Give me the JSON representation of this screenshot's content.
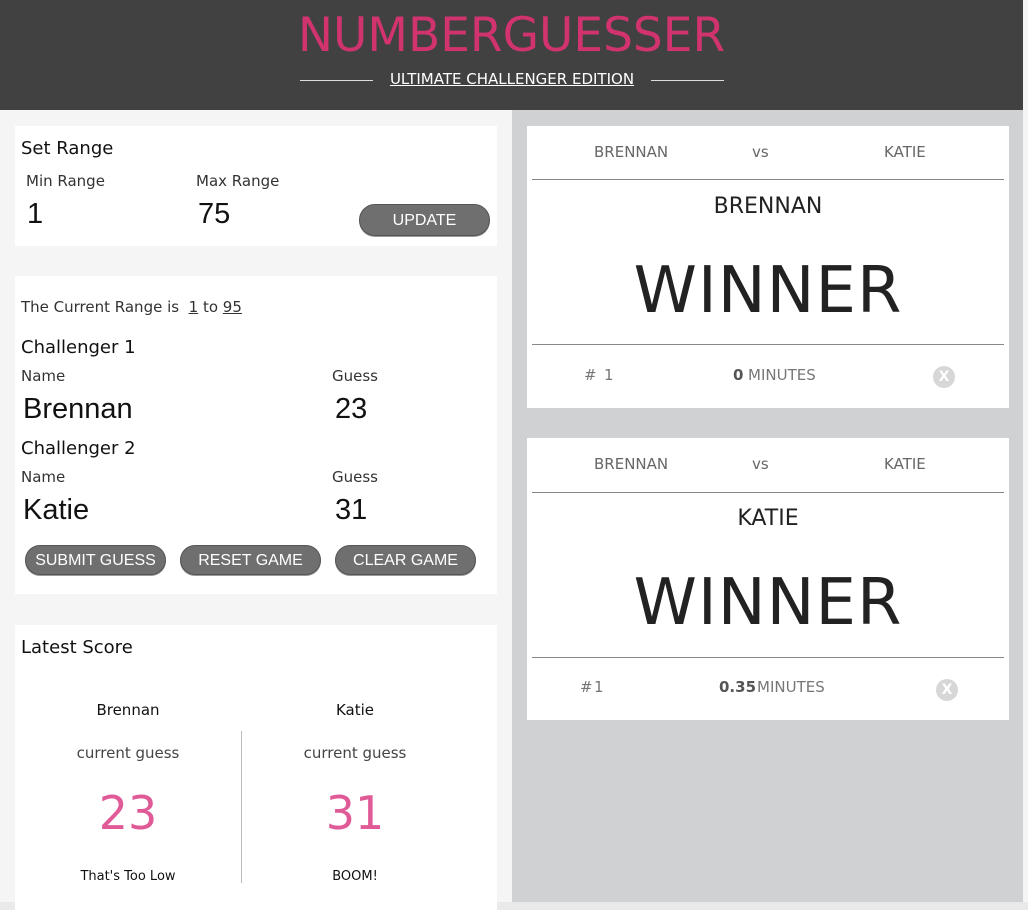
{
  "header": {
    "title": "NUMBERGUESSER",
    "subtitle": "ULTIMATE CHALLENGER EDITION"
  },
  "set_range": {
    "heading": "Set Range",
    "min_label": "Min Range",
    "max_label": "Max Range",
    "min_value": "1",
    "max_value": "75",
    "update_label": "UPDATE"
  },
  "challenge": {
    "range_prefix": "The Current Range is",
    "range_min": "1",
    "range_to": "to",
    "range_max": "95",
    "challengers": [
      {
        "heading": "Challenger 1",
        "name_label": "Name",
        "guess_label": "Guess",
        "name": "Brennan",
        "guess": "23"
      },
      {
        "heading": "Challenger 2",
        "name_label": "Name",
        "guess_label": "Guess",
        "name": "Katie",
        "guess": "31"
      }
    ],
    "buttons": {
      "submit": "SUBMIT GUESS",
      "reset": "RESET GAME",
      "clear": "CLEAR GAME"
    }
  },
  "latest_score": {
    "heading": "Latest Score",
    "players": [
      {
        "name": "Brennan",
        "caption": "current guess",
        "guess": "23",
        "message": "That's Too Low"
      },
      {
        "name": "Katie",
        "caption": "current guess",
        "guess": "31",
        "message": "BOOM!"
      }
    ]
  },
  "results": [
    {
      "player1": "BRENNAN",
      "vs": "vs",
      "player2": "KATIE",
      "winner": "BRENNAN",
      "winner_label": "WINNER",
      "hash": "#",
      "guess_count": "1",
      "minutes": "0",
      "minutes_unit": "MINUTES",
      "close": "X"
    },
    {
      "player1": "BRENNAN",
      "vs": "vs",
      "player2": "KATIE",
      "winner": "KATIE",
      "winner_label": "WINNER",
      "hash": "#",
      "guess_count": "1",
      "minutes": "0.35",
      "minutes_unit": "MINUTES",
      "close": "X"
    }
  ],
  "colors": {
    "brand_pink": "#d1336e",
    "score_pink": "#e05a97",
    "header_bg": "#414141",
    "button_bg": "#6f6f6f",
    "results_bg": "#d0d1d3"
  }
}
